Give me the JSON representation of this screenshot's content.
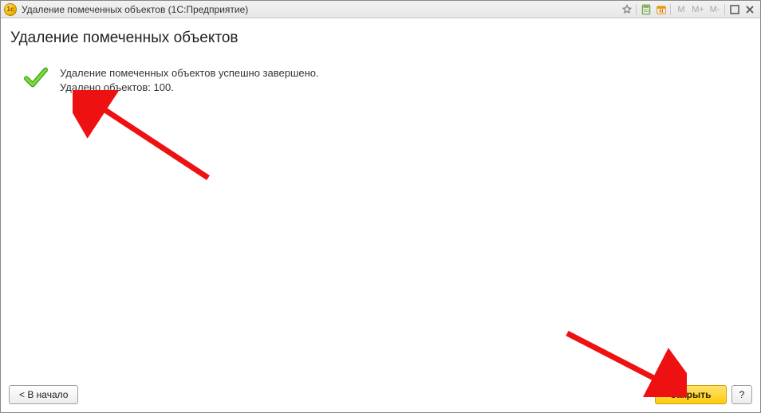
{
  "window": {
    "title": "Удаление помеченных объектов  (1С:Предприятие)",
    "mem_labels": {
      "m": "M",
      "m_plus": "M+",
      "m_minus": "M-"
    }
  },
  "page": {
    "heading": "Удаление помеченных объектов",
    "success_line1": "Удаление помеченных объектов успешно завершено.",
    "success_line2": "Удалено объектов: 100."
  },
  "footer": {
    "back_label": "< В начало",
    "close_label": "Закрыть",
    "help_label": "?"
  }
}
